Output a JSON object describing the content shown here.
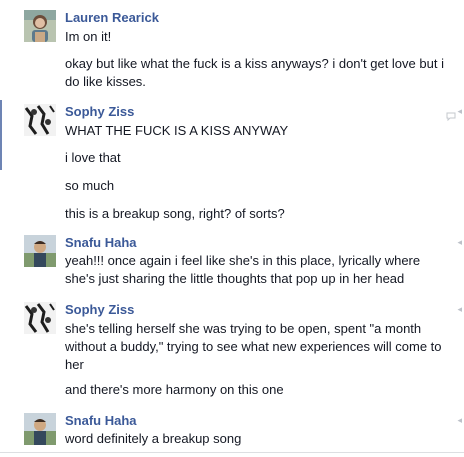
{
  "messages": [
    {
      "author": "Lauren Rearick",
      "lines": [
        "Im on it!",
        "okay but like what the fuck is a kiss anyways? i don't get love but i do like kisses."
      ]
    },
    {
      "author": "Sophy Ziss",
      "lines": [
        "WHAT THE FUCK IS A KISS ANYWAY",
        "i love that",
        "so much",
        "this is a breakup song, right? of sorts?"
      ]
    },
    {
      "author": "Snafu Haha",
      "lines": [
        "yeah!!! once again i feel like she's in this place, lyrically where she's just sharing the little thoughts that pop up in her head"
      ]
    },
    {
      "author": "Sophy Ziss",
      "lines": [
        "she's telling herself she was trying to be open, spent \"a month without a buddy,\" trying to see what new experiences will come to her",
        "and there's more harmony on this one"
      ]
    },
    {
      "author": "Snafu Haha",
      "lines": [
        "word definitely a breakup song"
      ]
    }
  ],
  "colors": {
    "author": "#3b5998",
    "text": "#141823",
    "muted": "#bdc1c9",
    "accent": "#6d84b4"
  },
  "icons": {
    "comment": "speech-bubble-icon",
    "avatar": "avatar"
  }
}
